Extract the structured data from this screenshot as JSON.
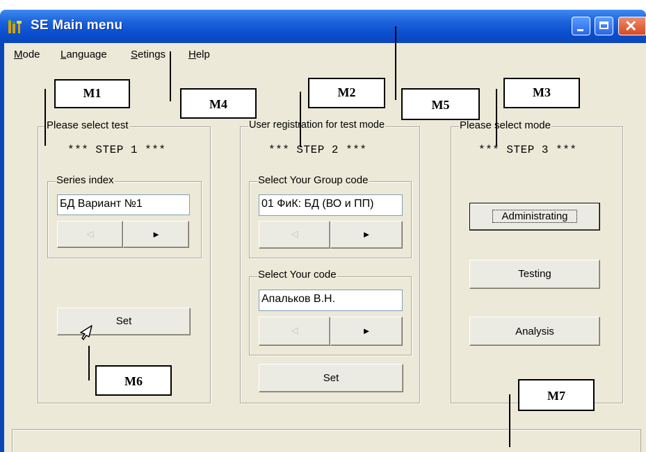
{
  "window": {
    "title": "SE Main menu",
    "close_glyph": "✕"
  },
  "menu": [
    {
      "prefix": "",
      "underline": "M",
      "rest": "ode"
    },
    {
      "prefix": "",
      "underline": "L",
      "rest": "anguage"
    },
    {
      "prefix": "",
      "underline": "S",
      "rest": "etings"
    },
    {
      "prefix": "",
      "underline": "H",
      "rest": "elp"
    }
  ],
  "step1": {
    "legend": "Please select test",
    "step": "*** STEP 1 ***",
    "series_legend": "Series index",
    "series_value": "БД Вариант №1",
    "prev": "◁",
    "next": "►",
    "set": "Set"
  },
  "step2": {
    "legend": "User registration for test mode",
    "step": "*** STEP 2 ***",
    "group_legend": "Select Your Group code",
    "group_value": "01 ФиК: БД (ВО и ПП)",
    "code_legend": "Select Your code",
    "code_value": "Апальков В.Н.",
    "prev": "◁",
    "next": "►",
    "set": "Set"
  },
  "step3": {
    "legend": "Please select mode",
    "step": "*** STEP 3 ***",
    "administrating": "Administrating",
    "testing": "Testing",
    "analysis": "Analysis"
  },
  "labels": {
    "m1": "M1",
    "m2": "M2",
    "m3": "M3",
    "m4": "M4",
    "m5": "M5",
    "m6": "M6",
    "m7": "M7"
  },
  "colors": {
    "titlebar": "#0b46b9",
    "client": "#ece9d8",
    "close": "#d64a24"
  },
  "icons": {
    "app": "app-icon",
    "cursor": "arrow-cursor-icon"
  }
}
